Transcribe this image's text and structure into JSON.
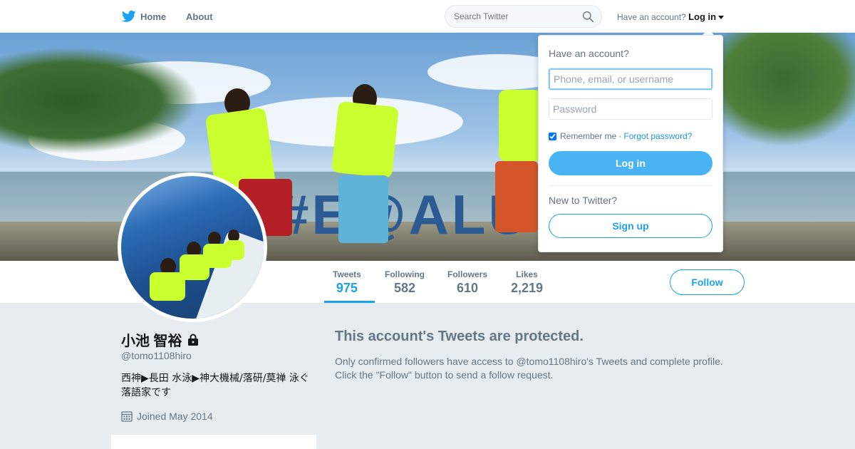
{
  "topnav": {
    "home_label": "Home",
    "about_label": "About",
    "search_placeholder": "Search Twitter",
    "have_account_label": "Have an account?",
    "login_label": "Log in"
  },
  "profile": {
    "name": "小池 智裕",
    "handle": "@tomo1108hiro",
    "bio": "西神▶長田 水泳▶神大機械/落研/莫禅 泳ぐ落語家です",
    "joined": "Joined May 2014",
    "banner_letters": "#E@ALU"
  },
  "stats": [
    {
      "label": "Tweets",
      "value": "975"
    },
    {
      "label": "Following",
      "value": "582"
    },
    {
      "label": "Followers",
      "value": "610"
    },
    {
      "label": "Likes",
      "value": "2,219"
    }
  ],
  "follow_label": "Follow",
  "protected": {
    "title": "This account's Tweets are protected.",
    "body": "Only confirmed followers have access to @tomo1108hiro's Tweets and complete profile. Click the \"Follow\" button to send a follow request."
  },
  "login_dropdown": {
    "heading": "Have an account?",
    "username_placeholder": "Phone, email, or username",
    "password_placeholder": "Password",
    "remember_label": "Remember me",
    "separator": "·",
    "forgot_label": "Forgot password?",
    "login_button": "Log in",
    "new_label": "New to Twitter?",
    "signup_button": "Sign up"
  },
  "colors": {
    "accent": "#1da1f2",
    "login_button": "#4ab3f4",
    "muted_text": "#657786",
    "page_background": "#e6ecf0"
  }
}
